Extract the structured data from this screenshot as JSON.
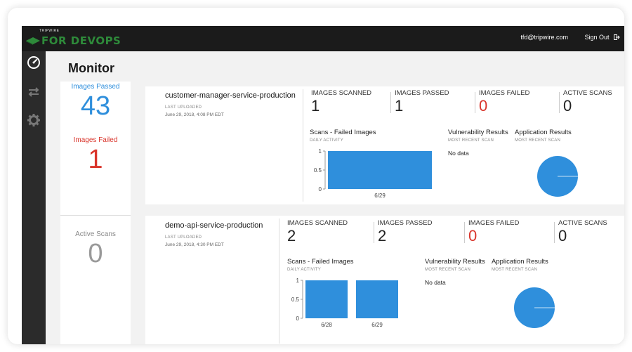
{
  "header": {
    "logo_small": "TRIPWIRE",
    "logo_text": "FOR DEVOPS",
    "user_email": "tfd@tripwire.com",
    "sign_out_label": "Sign Out"
  },
  "page": {
    "title": "Monitor"
  },
  "summary": {
    "passed_label": "Images Passed",
    "passed_value": "43",
    "failed_label": "Images Failed",
    "failed_value": "1",
    "active_label": "Active Scans",
    "active_value": "0"
  },
  "services": [
    {
      "name": "customer-manager-service-production",
      "last_uploaded_label": "LAST UPLOADED",
      "last_uploaded": "June 29, 2018, 4:08 PM EDT",
      "metrics": [
        {
          "label": "IMAGES SCANNED",
          "value": "1"
        },
        {
          "label": "IMAGES PASSED",
          "value": "1"
        },
        {
          "label": "IMAGES FAILED",
          "value": "0"
        },
        {
          "label": "ACTIVE SCANS",
          "value": "0"
        }
      ],
      "scans_title": "Scans - Failed Images",
      "scans_sub": "DAILY ACTIVITY",
      "vuln_title": "Vulnerability Results",
      "vuln_sub": "MOST RECENT SCAN",
      "vuln_nodata": "No data",
      "app_title": "Application Results",
      "app_sub": "MOST RECENT SCAN"
    },
    {
      "name": "demo-api-service-production",
      "last_uploaded_label": "LAST UPLOADED",
      "last_uploaded": "June 29, 2018, 4:30 PM EDT",
      "metrics": [
        {
          "label": "IMAGES SCANNED",
          "value": "2"
        },
        {
          "label": "IMAGES PASSED",
          "value": "2"
        },
        {
          "label": "IMAGES FAILED",
          "value": "0"
        },
        {
          "label": "ACTIVE SCANS",
          "value": "0"
        }
      ],
      "scans_title": "Scans - Failed Images",
      "scans_sub": "DAILY ACTIVITY",
      "vuln_title": "Vulnerability Results",
      "vuln_sub": "MOST RECENT SCAN",
      "vuln_nodata": "No data",
      "app_title": "Application Results",
      "app_sub": "MOST RECENT SCAN"
    }
  ],
  "chart_data": [
    {
      "type": "bar",
      "categories": [
        "6/29"
      ],
      "values": [
        1
      ],
      "ylim": [
        0,
        1
      ],
      "yticks": [
        "0",
        "0.5",
        "1"
      ],
      "color": "#2f8fdc"
    },
    {
      "type": "bar",
      "categories": [
        "6/28",
        "6/29"
      ],
      "values": [
        1,
        1
      ],
      "ylim": [
        0,
        1
      ],
      "yticks": [
        "0",
        "0.5",
        "1"
      ],
      "color": "#2f8fdc"
    },
    {
      "type": "pie",
      "values": [
        1
      ],
      "color": "#2f8fdc"
    },
    {
      "type": "pie",
      "values": [
        1
      ],
      "color": "#2f8fdc"
    }
  ],
  "colors": {
    "accent": "#2f8fdc",
    "failed": "#d9342b",
    "brand": "#2e8a3a"
  }
}
